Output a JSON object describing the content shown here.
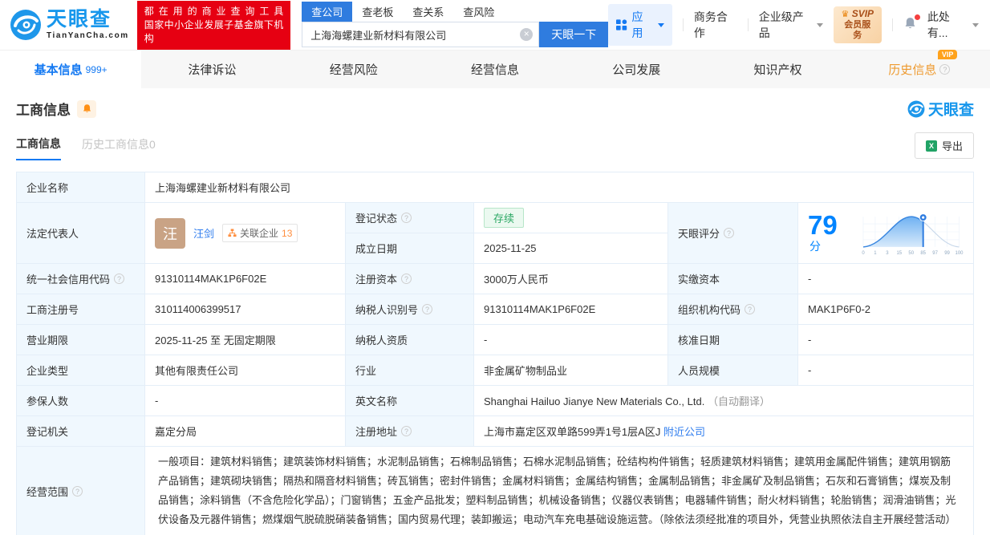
{
  "header": {
    "logo": {
      "name": "天眼查",
      "domain": "TianYanCha.com"
    },
    "slogan_line1": "都在用的商业查询工具",
    "slogan_line2": "国家中小企业发展子基金旗下机构",
    "search": {
      "tabs": [
        {
          "label": "查公司"
        },
        {
          "label": "查老板"
        },
        {
          "label": "查关系"
        },
        {
          "label": "查风险"
        }
      ],
      "value": "上海海螺建业新材料有限公司",
      "button": "天眼一下"
    },
    "nav": {
      "apps": "应用",
      "cooperation": "商务合作",
      "enterprise": "企业级产品",
      "svip_line1": "SVIP",
      "svip_crown": "♛",
      "svip_line2": "会员服务",
      "more": "此处有..."
    }
  },
  "tabs": [
    {
      "label": "基本信息",
      "badge": "999+"
    },
    {
      "label": "法律诉讼"
    },
    {
      "label": "经营风险"
    },
    {
      "label": "经营信息"
    },
    {
      "label": "公司发展"
    },
    {
      "label": "知识产权"
    },
    {
      "label": "历史信息",
      "vip": "VIP"
    }
  ],
  "section": {
    "title": "工商信息",
    "subtab_active": "工商信息",
    "subtab_inactive": "历史工商信息0",
    "export_label": "导出",
    "excel_glyph": "X",
    "watermark": "天眼查"
  },
  "icons": {
    "help": "?",
    "clear": "×"
  },
  "fields": {
    "company_name": {
      "label": "企业名称",
      "value": "上海海螺建业新材料有限公司"
    },
    "legal_rep": {
      "label": "法定代表人",
      "avatar": "汪",
      "name": "汪剑",
      "related_label": "关联企业",
      "related_count": "13"
    },
    "reg_status": {
      "label": "登记状态",
      "value": "存续"
    },
    "establish_date": {
      "label": "成立日期",
      "value": "2025-11-25"
    },
    "tyc_score": {
      "label": "天眼评分",
      "value": "79",
      "unit": "分"
    },
    "credit_code": {
      "label": "统一社会信用代码",
      "value": "91310114MAK1P6F02E"
    },
    "reg_capital": {
      "label": "注册资本",
      "value": "3000万人民币"
    },
    "paid_capital": {
      "label": "实缴资本",
      "value": "-"
    },
    "reg_number": {
      "label": "工商注册号",
      "value": "310114006399517"
    },
    "taxpayer_id": {
      "label": "纳税人识别号",
      "value": "91310114MAK1P6F02E"
    },
    "org_code": {
      "label": "组织机构代码",
      "value": "MAK1P6F0-2"
    },
    "business_term": {
      "label": "营业期限",
      "value": "2025-11-25 至 无固定期限"
    },
    "taxpayer_quals": {
      "label": "纳税人资质",
      "value": "-"
    },
    "approval_date": {
      "label": "核准日期",
      "value": "-"
    },
    "company_type": {
      "label": "企业类型",
      "value": "其他有限责任公司"
    },
    "industry": {
      "label": "行业",
      "value": "非金属矿物制品业"
    },
    "staff_size": {
      "label": "人员规模",
      "value": "-"
    },
    "insured_count": {
      "label": "参保人数",
      "value": "-"
    },
    "english_name": {
      "label": "英文名称",
      "value": "Shanghai Hailuo Jianye New Materials Co., Ltd.",
      "note": "（自动翻译）"
    },
    "reg_authority": {
      "label": "登记机关",
      "value": "嘉定分局"
    },
    "reg_address": {
      "label": "注册地址",
      "value": "上海市嘉定区双单路599弄1号1层A区J",
      "link": "附近公司"
    },
    "business_scope": {
      "label": "经营范围",
      "value": "一般项目：建筑材料销售；建筑装饰材料销售；水泥制品销售；石棉制品销售；石棉水泥制品销售；砼结构构件销售；轻质建筑材料销售；建筑用金属配件销售；建筑用钢筋产品销售；建筑砌块销售；隔热和隔音材料销售；砖瓦销售；密封件销售；金属材料销售；金属结构销售；金属制品销售；非金属矿及制品销售；石灰和石膏销售；煤炭及制品销售；涂料销售（不含危险化学品）；门窗销售；五金产品批发；塑料制品销售；机械设备销售；仪器仪表销售；电器辅件销售；耐火材料销售；轮胎销售；润滑油销售；光伏设备及元器件销售；燃煤烟气脱硫脱硝装备销售；国内贸易代理；装卸搬运；电动汽车充电基础设施运营。（除依法须经批准的项目外，凭营业执照依法自主开展经营活动）"
    }
  },
  "score_chart": {
    "type": "area",
    "score": "79",
    "marker_tick": "85",
    "ticks": [
      "0",
      "1",
      "3",
      "15",
      "50",
      "85",
      "97",
      "99",
      "100"
    ]
  },
  "colors": {
    "brand_blue": "#1897EC",
    "banner_red": "#E60012",
    "link_blue": "#2E7CEE",
    "score_blue": "#0084FF",
    "status_green": "#2BA864",
    "vip_orange": "#FFA21C"
  }
}
